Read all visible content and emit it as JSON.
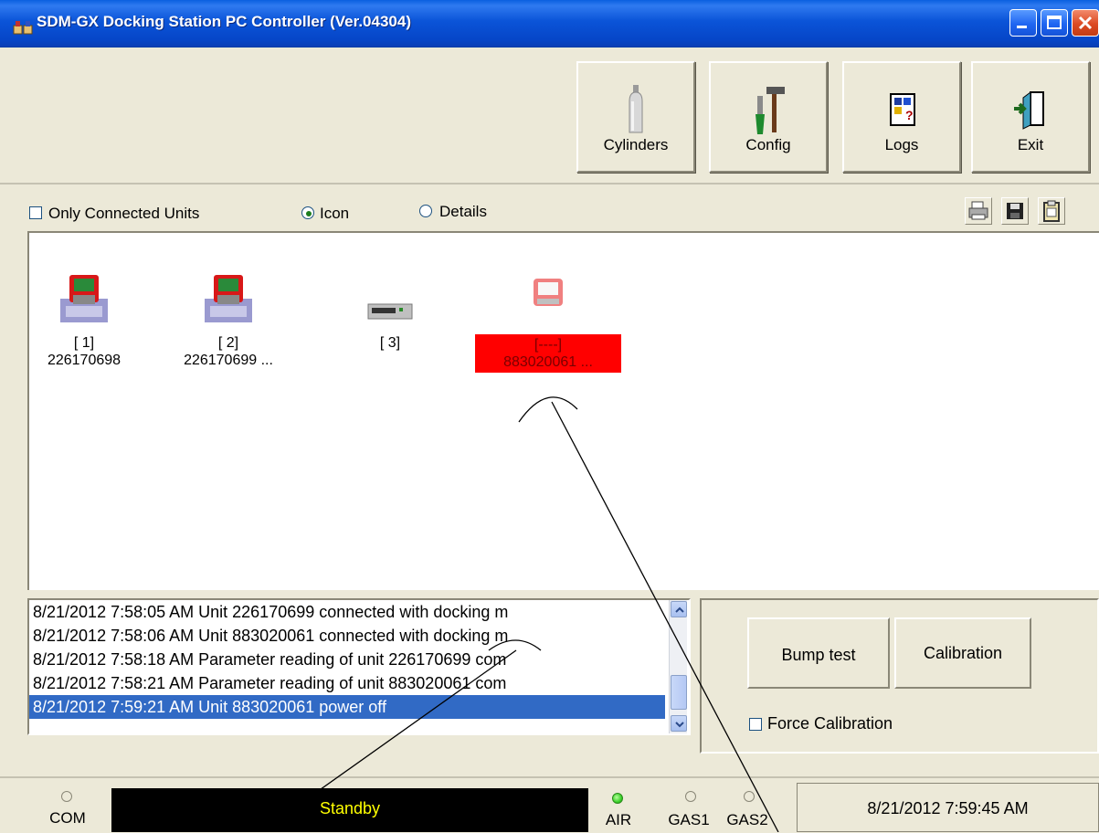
{
  "window": {
    "title": "SDM-GX Docking Station PC Controller (Ver.04304)",
    "controls": [
      "minimize",
      "maximize",
      "close"
    ]
  },
  "toolbar": {
    "buttons": [
      {
        "label": "Cylinders",
        "icon": "cylinder-icon"
      },
      {
        "label": "Config",
        "icon": "tools-icon"
      },
      {
        "label": "Logs",
        "icon": "logbook-icon"
      },
      {
        "label": "Exit",
        "icon": "exit-door-icon"
      }
    ]
  },
  "options": {
    "only_connected_label": "Only Connected Units",
    "only_connected_checked": false,
    "view_icon_label": "Icon",
    "view_details_label": "Details",
    "view_selected": "Icon",
    "action_icons": [
      "print-icon",
      "save-icon",
      "clipboard-icon"
    ]
  },
  "units": [
    {
      "slot": "[ 1]",
      "serial": "226170698",
      "icon": "docked-instrument-icon"
    },
    {
      "slot": "[ 2]",
      "serial": "226170699  ...",
      "icon": "docked-instrument-icon"
    },
    {
      "slot": "[ 3]",
      "serial": "",
      "icon": "empty-dock-icon"
    },
    {
      "slot": "[----]",
      "serial": "883020061  ...",
      "icon": "disconnected-instrument-icon",
      "selected": true
    }
  ],
  "log": {
    "entries": [
      "8/21/2012 7:58:05 AM Unit 226170699 connected with docking m",
      "8/21/2012 7:58:06 AM Unit 883020061 connected with docking m",
      "8/21/2012 7:58:18 AM Parameter reading of unit 226170699 com",
      "8/21/2012 7:58:21 AM Parameter reading of unit 883020061 com",
      "8/21/2012 7:59:21 AM Unit 883020061 power off"
    ],
    "selected_index": 4
  },
  "actions": {
    "bump_label": "Bump test",
    "calibration_label": "Calibration",
    "force_calibration_label": "Force Calibration",
    "force_calibration_checked": false
  },
  "status": {
    "com_label": "COM",
    "message": "Standby",
    "air_label": "AIR",
    "gas1_label": "GAS1",
    "gas2_label": "GAS2",
    "air_led_color": "#3ad02a",
    "datetime": "8/21/2012 7:59:45 AM"
  }
}
